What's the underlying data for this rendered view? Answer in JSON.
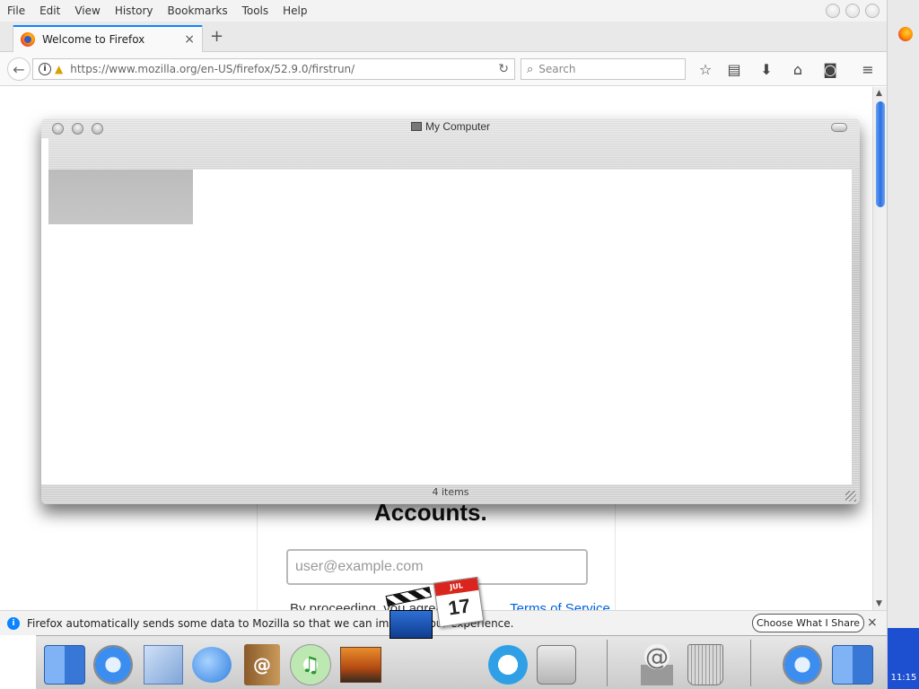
{
  "menu": [
    "File",
    "Edit",
    "View",
    "History",
    "Bookmarks",
    "Tools",
    "Help"
  ],
  "tab": {
    "title": "Welcome to Firefox",
    "close": "×",
    "new_tab": "+"
  },
  "navbar": {
    "url": "https://www.mozilla.org/en-US/firefox/52.9.0/firstrun/",
    "search_placeholder": "Search"
  },
  "page": {
    "heading_fragment": "Accounts.",
    "email_placeholder": "user@example.com",
    "terms_prefix": "By proceeding, you agree",
    "terms_link": "Terms of Service"
  },
  "finder": {
    "title": "My Computer",
    "status": "4 items"
  },
  "notification": {
    "text": "Firefox automatically sends some data to Mozilla so that we can improve your experience.",
    "button": "Choose What I Share",
    "close": "×"
  },
  "dock": {
    "calendar_month": "JUL",
    "calendar_day": "17"
  },
  "clock": "11:15",
  "colors": {
    "accent": "#0a84ff",
    "link": "#0060df",
    "dock_active": "#1d4fd1"
  }
}
